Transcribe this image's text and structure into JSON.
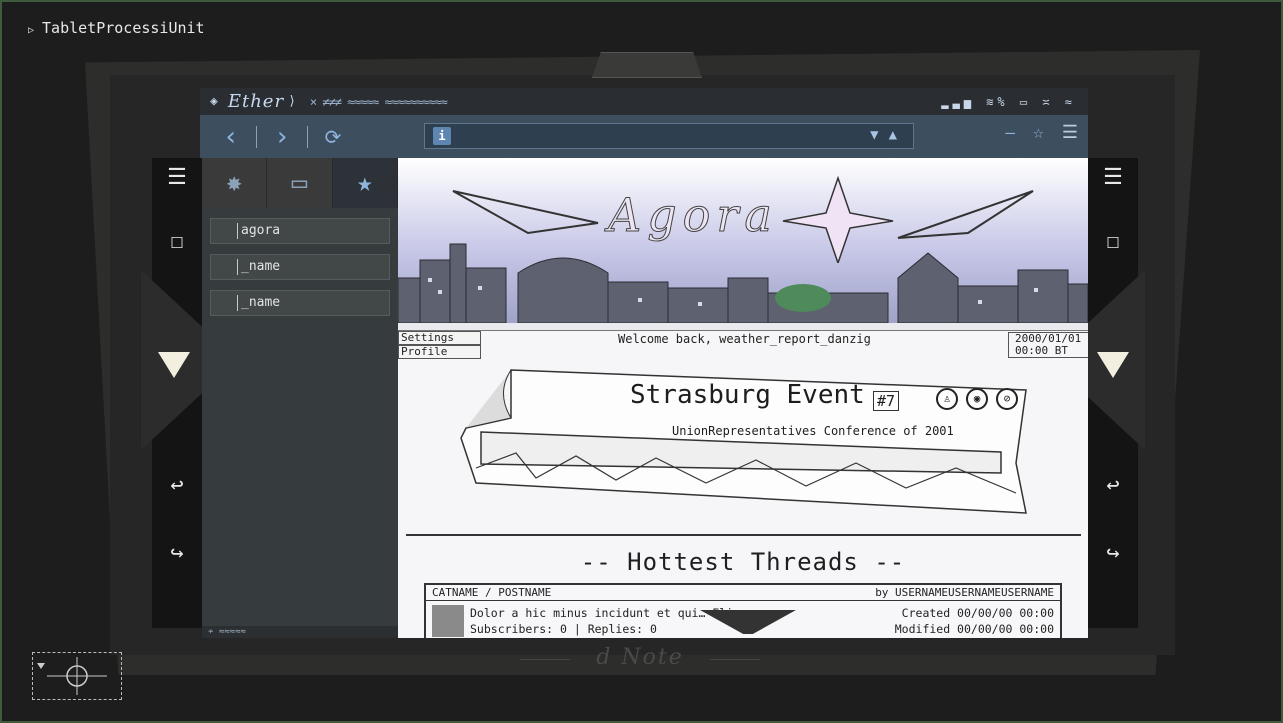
{
  "debug": {
    "label": "TabletProcessiUnit"
  },
  "browser": {
    "name": "Ether",
    "footer_label": "d Note"
  },
  "sidebar": {
    "items": [
      {
        "label": "agora"
      },
      {
        "label": "_name"
      },
      {
        "label": "_name"
      }
    ]
  },
  "page": {
    "banner_title": "Agora",
    "tabs": {
      "settings": "Settings",
      "profile": "Profile"
    },
    "welcome": "Welcome back, weather_report_danzig",
    "clock": {
      "date": "2000/01/01",
      "time": "00:00 BT"
    },
    "event": {
      "title": "Strasburg Event",
      "number": "#7",
      "subtitle": "UnionRepresentatives Conference of 2001"
    },
    "hottest_title": "-- Hottest Threads --",
    "thread": {
      "category": "CATNAME / POSTNAME",
      "author": "by USERNAMEUSERNAMEUSERNAME",
      "excerpt": "Dolor a hic minus incidunt et qui… Eligen…",
      "stats": "Subscribers: 0 | Replies: 0",
      "created": "Created 00/00/00 00:00",
      "modified": "Modified 00/00/00 00:00"
    }
  },
  "colors": {
    "background": "#1c1d1c",
    "nav_accent": "#8fb4dd",
    "content_bg": "#f6f6f8"
  }
}
